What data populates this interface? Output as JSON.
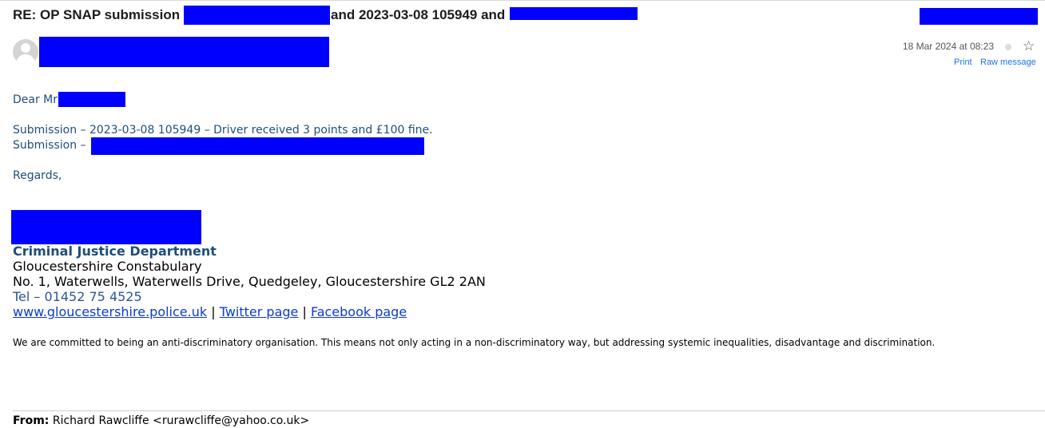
{
  "email": {
    "subject_prefix": "RE: OP SNAP submission",
    "subject_mid": "and 2023-03-08 105949 and",
    "date": "18 Mar 2024 at 08:23",
    "print_label": "Print",
    "raw_label": "Raw message",
    "icons": {
      "avatar": "user-avatar-icon",
      "star": "star-icon",
      "status": "status-dot-icon"
    }
  },
  "body": {
    "greeting": "Dear Mr",
    "line1": "Submission – 2023-03-08 105949 – Driver received 3 points and £100 fine.",
    "line2": "Submission –",
    "regards": "Regards,"
  },
  "signature": {
    "department": "Criminal Justice Department",
    "org": "Gloucestershire Constabulary",
    "address": "No. 1, Waterwells, Waterwells Drive, Quedgeley, Gloucestershire GL2 2AN",
    "tel": "Tel – 01452 75 4525",
    "website": "www.gloucestershire.police.uk",
    "sep": "|",
    "twitter": "Twitter page",
    "facebook": "Facebook page"
  },
  "notice": "We are committed to being an anti-discriminatory organisation. This means not only acting in a non-discriminatory way, but addressing systemic inequalities, disadvantage and discrimination.",
  "quoted": {
    "from_label": "From:",
    "from_value": "Richard Rawcliffe <rurawcliffe@yahoo.co.uk>"
  },
  "colors": {
    "redaction": "#0000ff",
    "body_text": "#1f4e79",
    "link": "#0b3bd3"
  }
}
